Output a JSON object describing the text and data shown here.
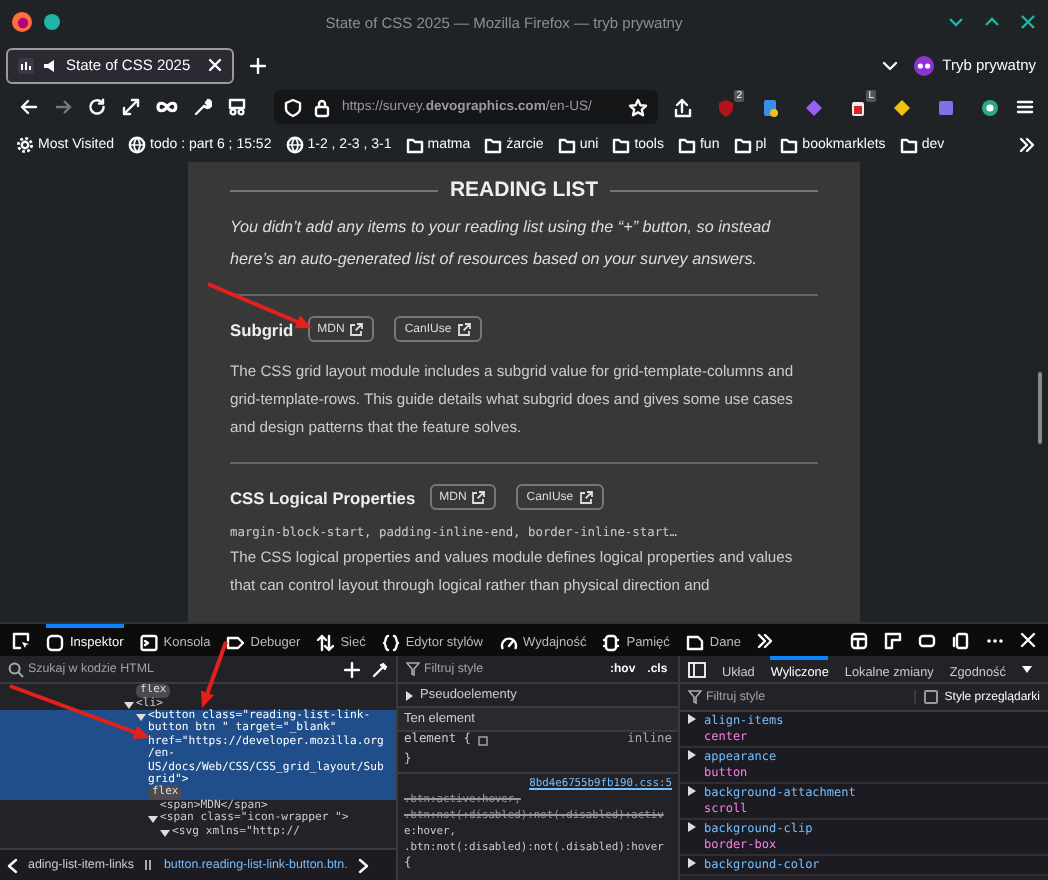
{
  "window": {
    "title": "State of CSS 2025 — Mozilla Firefox — tryb prywatny"
  },
  "tabs": [
    {
      "label": "State of CSS 2025",
      "selected": true
    }
  ],
  "private_mode": {
    "label": "Tryb prywatny"
  },
  "address_bar": {
    "url": "https://survey.**devographics.com**/en-US/"
  },
  "extensions": [
    {
      "kind": "shield",
      "badge": "2"
    },
    {
      "kind": "doc"
    },
    {
      "kind": "diamond"
    },
    {
      "kind": "clip",
      "badge": "L"
    },
    {
      "kind": "sign"
    },
    {
      "kind": "puzzle"
    },
    {
      "kind": "ring"
    }
  ],
  "bookmarks": [
    {
      "label": "Most Visited",
      "kind": "gear"
    },
    {
      "label": "todo : part 6 ; 15:52",
      "kind": "globe"
    },
    {
      "label": "1-2 , 2-3 , 3-1",
      "kind": "globe"
    },
    {
      "label": "matma",
      "kind": "folder"
    },
    {
      "label": "żarcie",
      "kind": "folder"
    },
    {
      "label": "uni",
      "kind": "folder"
    },
    {
      "label": "tools",
      "kind": "folder"
    },
    {
      "label": "fun",
      "kind": "folder"
    },
    {
      "label": "pl",
      "kind": "folder"
    },
    {
      "label": "bookmarklets",
      "kind": "folder"
    },
    {
      "label": "dev",
      "kind": "folder"
    }
  ],
  "page": {
    "heading": "READING LIST",
    "intro": "You didn’t add any items to your reading list using the “+” button, so instead here’s an auto-generated list of resources based on your survey answers.",
    "items": [
      {
        "title": "Subgrid",
        "links": [
          "MDN",
          "CanIUse"
        ],
        "description": "The CSS grid layout module includes a subgrid value for grid-template-columns and grid-template-rows. This guide details what subgrid does and gives some use cases and design patterns that the feature solves."
      },
      {
        "title": "CSS Logical Properties",
        "links": [
          "MDN",
          "CanIUse"
        ],
        "code": "margin-block-start, padding-inline-end, border-inline-start…",
        "description": "The CSS logical properties and values module defines logical properties and values that can control layout through logical rather than physical direction and"
      }
    ]
  },
  "devtools": {
    "tabs": [
      {
        "label": "Inspektor",
        "kind": "inspector",
        "selected": true
      },
      {
        "label": "Konsola",
        "kind": "console",
        "selected": false
      },
      {
        "label": "Debuger",
        "kind": "debugger",
        "selected": false
      },
      {
        "label": "Sieć",
        "kind": "network",
        "selected": false
      },
      {
        "label": "Edytor stylów",
        "kind": "style",
        "selected": false
      },
      {
        "label": "Wydajność",
        "kind": "perf",
        "selected": false
      },
      {
        "label": "Pamięć",
        "kind": "memory",
        "selected": false
      },
      {
        "label": "Dane",
        "kind": "storage",
        "selected": false
      }
    ],
    "search": {
      "placeholder": "Szukaj w kodzie HTML"
    },
    "tree": [
      {
        "kind": "badge",
        "text": "flex",
        "selected": false
      },
      {
        "kind": "tag",
        "text": "<li>",
        "expanded": true,
        "selected": false,
        "children": [
          {
            "kind": "tag",
            "text": "<button class=\"reading-list-link-button btn \" target=\"_blank\" href=\"https://developer.mozilla.org/en-US/docs/Web/CSS/CSS_grid_layout/Subgrid\">",
            "badge": "flex",
            "expanded": true,
            "selected": true,
            "children": [
              {
                "kind": "tag",
                "text": "<span>MDN</span>",
                "selected": false
              },
              {
                "kind": "tag",
                "text": "<span class=\"icon-wrapper \">",
                "expanded": true,
                "selected": false,
                "children": [
                  {
                    "kind": "tag",
                    "text": "<svg xmlns=\"http://",
                    "expanded": true,
                    "selected": false
                  }
                ]
              }
            ]
          }
        ]
      }
    ],
    "rules_filter": {
      "placeholder": "Filtruj style",
      "hov": ":hov",
      "cls": ".cls"
    },
    "rules": [
      {
        "kind": "toggle",
        "text": "Pseudoelementy"
      },
      {
        "kind": "section",
        "text": "Ten element"
      },
      {
        "kind": "code",
        "text": "element {",
        "note": "inline"
      },
      {
        "kind": "code",
        "text": "}"
      },
      {
        "kind": "source",
        "text": "8bd4e6755b9fb190.css:5"
      },
      {
        "kind": "selector",
        "text": ".btn:active:hover,",
        "overridden": true
      },
      {
        "kind": "selector",
        "text": ".btn:not(:disabled):not(.disabled):activ",
        "overridden": true
      },
      {
        "kind": "selector",
        "text": "e:hover,",
        "overridden": false
      },
      {
        "kind": "selector",
        "text": ".btn:not(:disabled):not(.disabled):hover",
        "overridden": false
      },
      {
        "kind": "code",
        "text": "{"
      }
    ],
    "side_tabs": [
      {
        "label": "Układ",
        "selected": false
      },
      {
        "label": "Wyliczone",
        "selected": true
      },
      {
        "label": "Lokalne zmiany",
        "selected": false
      },
      {
        "label": "Zgodność",
        "selected": false
      }
    ],
    "computed_filter": {
      "placeholder": "Filtruj style"
    },
    "browser_styles": {
      "label": "Style przeglądarki",
      "checked": false
    },
    "computed": [
      {
        "property": "align-items",
        "value": "center"
      },
      {
        "property": "appearance",
        "value": "button"
      },
      {
        "property": "background-attachment",
        "value": "scroll"
      },
      {
        "property": "background-clip",
        "value": "border-box"
      },
      {
        "property": "background-color"
      }
    ],
    "breadcrumbs": [
      "ading-list-item-links",
      "button.reading-list-link-button.btn."
    ]
  }
}
